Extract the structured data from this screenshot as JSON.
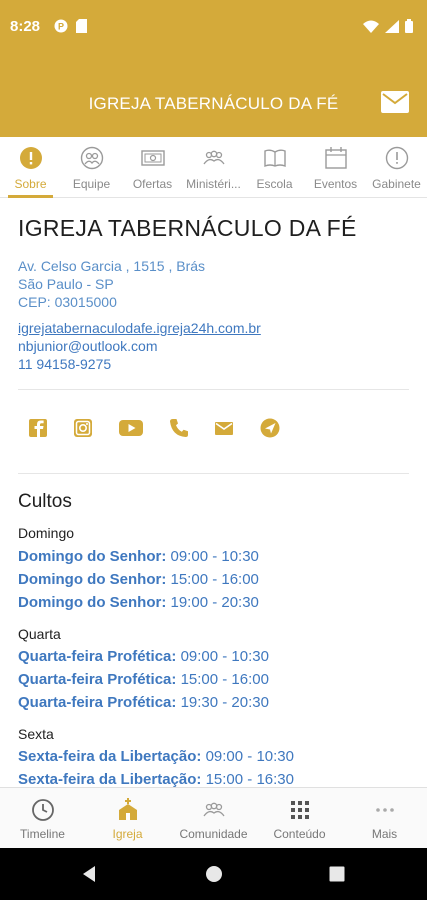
{
  "status_bar": {
    "time": "8:28"
  },
  "app_bar": {
    "title": "IGREJA TABERNÁCULO DA FÉ",
    "mail_icon": "mail-icon"
  },
  "colors": {
    "brand": "#d4aa3a",
    "link": "#3f78bf",
    "link_light": "#5a8fc8"
  },
  "tabs": [
    {
      "label": "Sobre",
      "icon": "info-icon",
      "active": true
    },
    {
      "label": "Equipe",
      "icon": "team-icon",
      "active": false
    },
    {
      "label": "Ofertas",
      "icon": "money-icon",
      "active": false
    },
    {
      "label": "Ministéri...",
      "icon": "group-icon",
      "active": false
    },
    {
      "label": "Escola",
      "icon": "book-icon",
      "active": false
    },
    {
      "label": "Eventos",
      "icon": "calendar-icon",
      "active": false
    },
    {
      "label": "Gabinete",
      "icon": "info-outline-icon",
      "active": false
    }
  ],
  "church": {
    "name": "IGREJA TABERNÁCULO DA FÉ",
    "address_line1": "Av. Celso Garcia , 1515 , Brás",
    "address_line2": "São Paulo - SP",
    "address_line3": "CEP: 03015000",
    "website": "igrejatabernaculodafe.igreja24h.com.br",
    "email": "nbjunior@outlook.com",
    "phone": "11 94158-9275"
  },
  "social": [
    "facebook-icon",
    "instagram-icon",
    "youtube-icon",
    "phone-icon",
    "mail-icon",
    "location-icon"
  ],
  "cultos": {
    "title": "Cultos",
    "days": [
      {
        "day": "Domingo",
        "services": [
          {
            "name": "Domingo do Senhor:",
            "time": "09:00 - 10:30"
          },
          {
            "name": "Domingo do Senhor:",
            "time": "15:00 - 16:00"
          },
          {
            "name": "Domingo do Senhor:",
            "time": "19:00 - 20:30"
          }
        ]
      },
      {
        "day": "Quarta",
        "services": [
          {
            "name": "Quarta-feira Profética:",
            "time": "09:00 - 10:30"
          },
          {
            "name": "Quarta-feira Profética:",
            "time": "15:00 - 16:00"
          },
          {
            "name": "Quarta-feira Profética:",
            "time": "19:30 - 20:30"
          }
        ]
      },
      {
        "day": "Sexta",
        "services": [
          {
            "name": "Sexta-feira da Libertação:",
            "time": "09:00 - 10:30"
          },
          {
            "name": "Sexta-feira da Libertação:",
            "time": "15:00 - 16:30"
          }
        ]
      }
    ]
  },
  "bottom_nav": [
    {
      "label": "Timeline",
      "icon": "clock-icon",
      "active": false
    },
    {
      "label": "Igreja",
      "icon": "church-icon",
      "active": true
    },
    {
      "label": "Comunidade",
      "icon": "community-icon",
      "active": false
    },
    {
      "label": "Conteúdo",
      "icon": "grid-icon",
      "active": false
    },
    {
      "label": "Mais",
      "icon": "more-icon",
      "active": false
    }
  ]
}
